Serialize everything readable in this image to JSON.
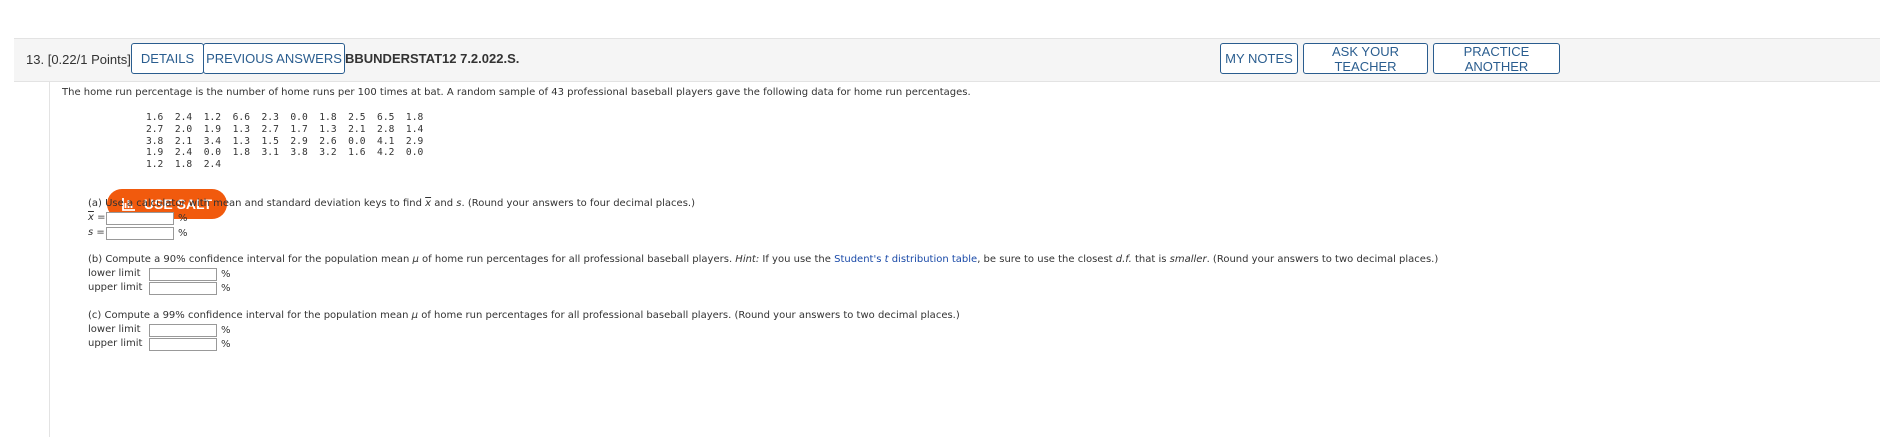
{
  "header": {
    "question_number": "13.",
    "points": "[0.22/1 Points]",
    "details_label": "DETAILS",
    "previous_answers_label": "PREVIOUS ANSWERS",
    "problem_code": "BBUNDERSTAT12 7.2.022.S.",
    "my_notes_label": "MY NOTES",
    "ask_teacher_label": "ASK YOUR TEACHER",
    "practice_another_label": "PRACTICE ANOTHER"
  },
  "intro": "The home run percentage is the number of home runs per 100 times at bat. A random sample of 43 professional baseball players gave the following data for home run percentages.",
  "data_rows": [
    "1.6  2.4  1.2  6.6  2.3  0.0  1.8  2.5  6.5  1.8",
    "2.7  2.0  1.9  1.3  2.7  1.7  1.3  2.1  2.8  1.4",
    "3.8  2.1  3.4  1.3  1.5  2.9  2.6  0.0  4.1  2.9",
    "1.9  2.4  0.0  1.8  3.1  3.8  3.2  1.6  4.2  0.0",
    "1.2  1.8  2.4"
  ],
  "salt_label": "USE SALT",
  "part_a": {
    "pre": "(a) Use a calculator with mean and standard deviation keys to find ",
    "xbar": "x",
    "mid": " and ",
    "s": "s",
    "post": ". (Round your answers to four decimal places.)",
    "xbar_label": "x",
    "s_label": "s",
    "equals": " =",
    "unit": "%"
  },
  "part_b": {
    "pre": "(b) Compute a 90% confidence interval for the population mean ",
    "mu": "μ",
    "mid": " of home run percentages for all professional baseball players. ",
    "hint": "Hint:",
    "hint_text": " If you use the ",
    "link_pre": "Student's ",
    "link_t": "t",
    "link_post": " distribution table",
    "after_link": ", be sure to use the closest ",
    "df": "d.f.",
    "that_is": " that is ",
    "smaller": "smaller",
    "post": ". (Round your answers to two decimal places.)",
    "lower_label": "lower limit",
    "upper_label": "upper limit",
    "unit": "%"
  },
  "part_c": {
    "pre": "(c) Compute a 99% confidence interval for the population mean ",
    "mu": "μ",
    "post": " of home run percentages for all professional baseball players. (Round your answers to two decimal places.)",
    "lower_label": "lower limit",
    "upper_label": "upper limit",
    "unit": "%"
  },
  "colors": {
    "salt": "#f15a0d",
    "button_border": "#2a5d8f",
    "link": "#1a4aa8"
  },
  "icons": {
    "salt": "salt-chart-icon"
  }
}
